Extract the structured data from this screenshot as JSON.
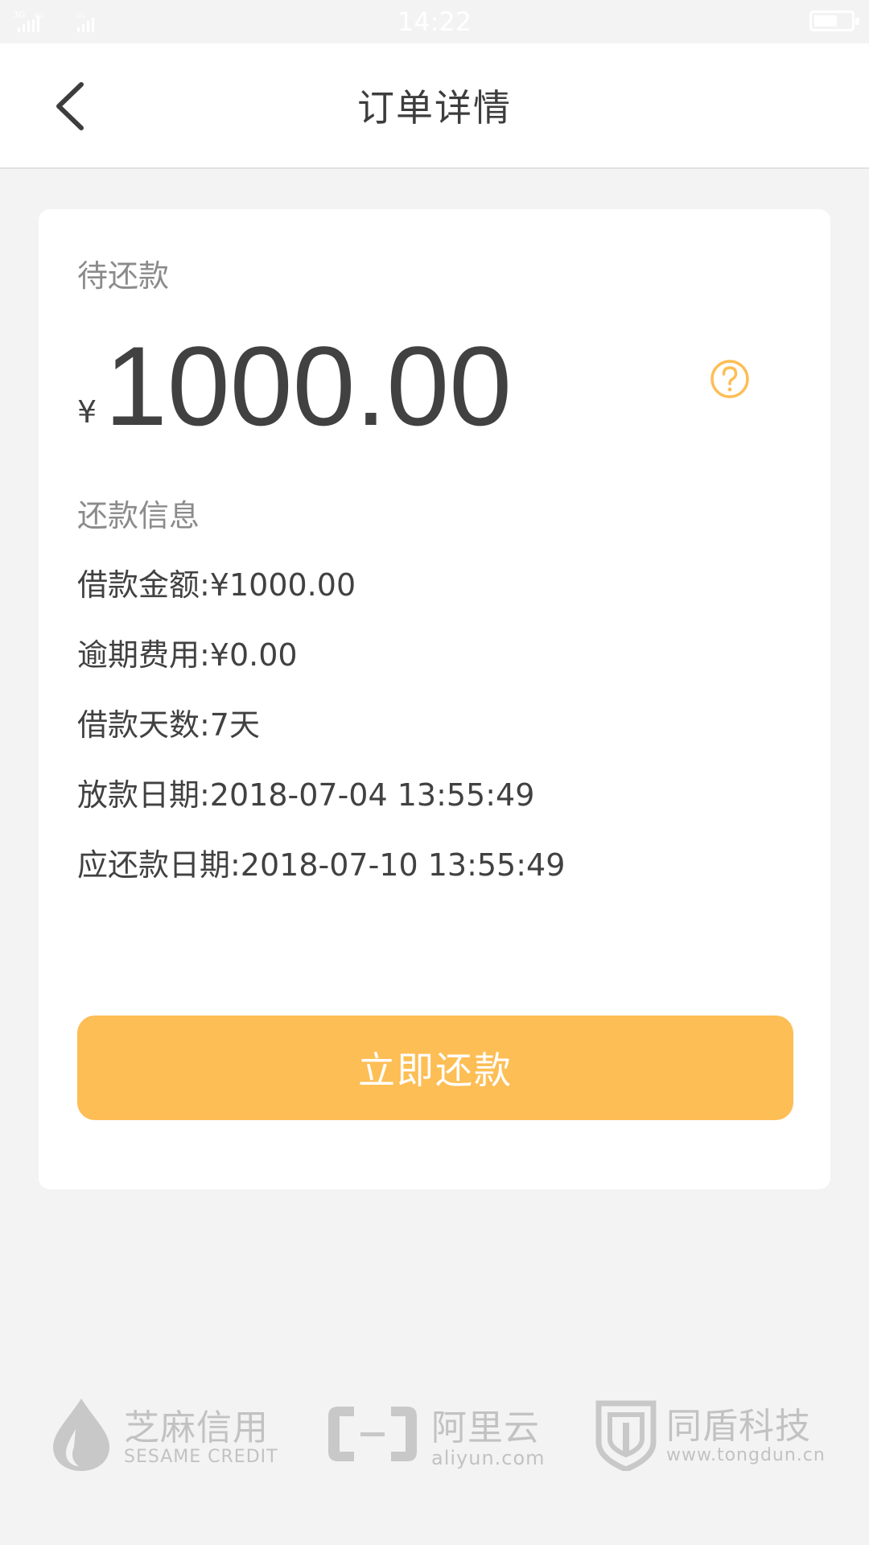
{
  "status_bar": {
    "time": "14:22",
    "signal_labels": [
      "3G",
      "3G",
      "3G"
    ]
  },
  "nav": {
    "title": "订单详情"
  },
  "card": {
    "pending_label": "待还款",
    "currency_symbol": "¥",
    "amount": "1000.00",
    "info_title": "还款信息",
    "rows": [
      "借款金额:¥1000.00",
      "逾期费用:¥0.00",
      "借款天数:7天",
      "放款日期:2018-07-04 13:55:49",
      "应还款日期:2018-07-10 13:55:49"
    ],
    "repay_button": "立即还款"
  },
  "partners": [
    {
      "name": "芝麻信用",
      "sub": "SESAME CREDIT",
      "icon": "sesame-drop-icon"
    },
    {
      "name": "阿里云",
      "sub": "aliyun.com",
      "icon": "aliyun-bracket-icon"
    },
    {
      "name": "同盾科技",
      "sub": "www.tongdun.cn",
      "icon": "tongdun-shield-icon"
    }
  ],
  "colors": {
    "accent": "#fdbe55",
    "background": "#f3f3f3",
    "text": "#414141",
    "muted": "#8b8b8b",
    "logo_grey": "#c2c2c2"
  }
}
